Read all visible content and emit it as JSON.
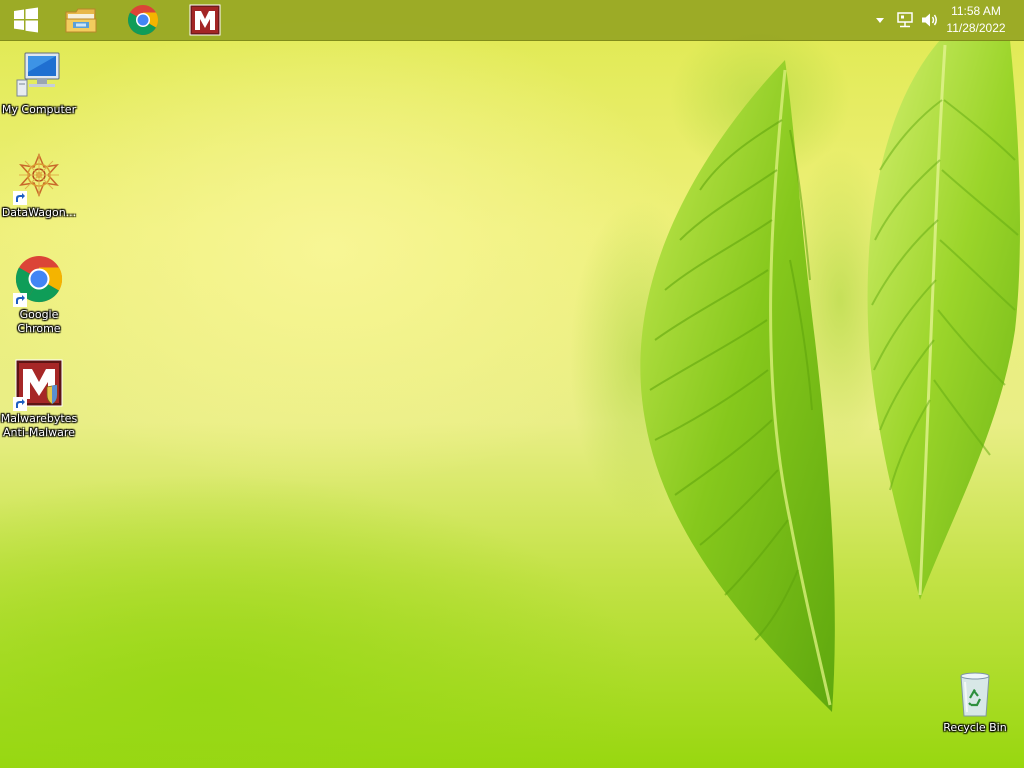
{
  "taskbar": {
    "pinned": [
      {
        "name": "start",
        "icon": "windows-logo-icon"
      },
      {
        "name": "file-explorer",
        "icon": "file-explorer-icon"
      },
      {
        "name": "chrome",
        "icon": "chrome-icon"
      },
      {
        "name": "malwarebytes",
        "icon": "malwarebytes-icon"
      }
    ],
    "tray": {
      "icons": [
        "show-hidden-icons-chevron",
        "network-icon",
        "volume-icon"
      ],
      "time": "11:58 AM",
      "date": "11/28/2022"
    }
  },
  "desktop": {
    "icons": [
      {
        "label": "My Computer",
        "icon": "computer-icon"
      },
      {
        "label": "DataWagon...",
        "icon": "datawagon-icon"
      },
      {
        "label": "Google Chrome",
        "label_lines": [
          "Google",
          "Chrome"
        ],
        "icon": "chrome-icon"
      },
      {
        "label": "Malwarebytes Anti-Malware",
        "label_lines": [
          "Malwarebytes",
          "Anti-Malware"
        ],
        "icon": "malwarebytes-icon"
      },
      {
        "label": "Recycle Bin",
        "icon": "recycle-bin-icon"
      }
    ]
  },
  "colors": {
    "taskbar": "#96a523",
    "wallpaper_light": "#eef07a",
    "wallpaper_green": "#98d70f",
    "leaf": "#7cc21a"
  }
}
